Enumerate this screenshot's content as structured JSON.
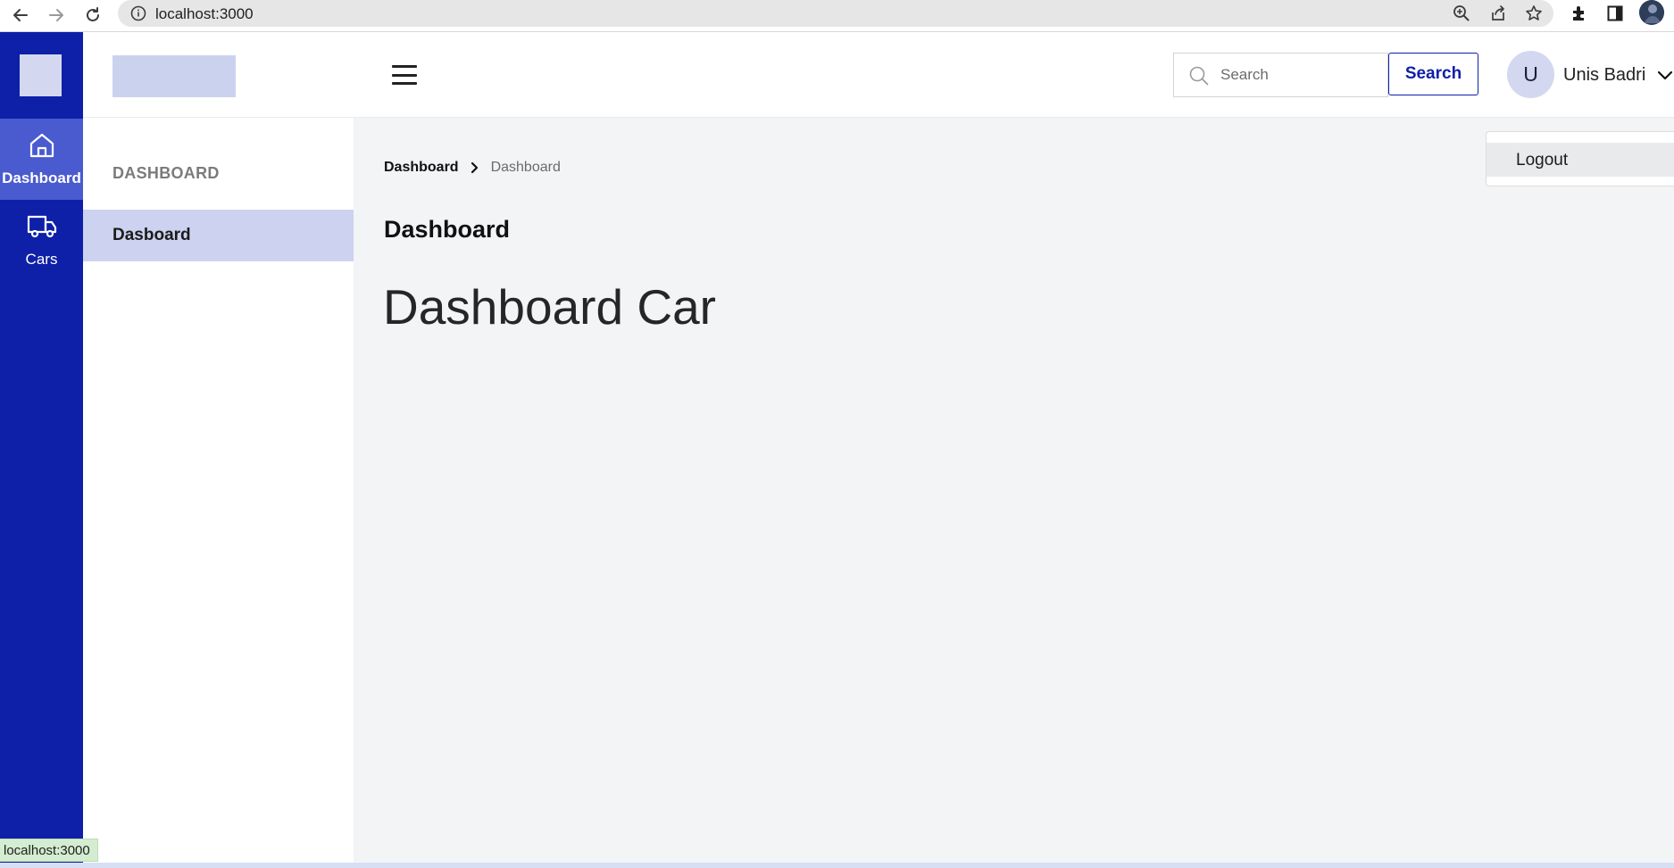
{
  "browser": {
    "url": "localhost:3000",
    "status_url": "localhost:3000"
  },
  "rail": {
    "items": [
      {
        "label": "Dashboard",
        "icon": "home-icon",
        "active": true
      },
      {
        "label": "Cars",
        "icon": "truck-icon",
        "active": false
      }
    ]
  },
  "header": {
    "search_placeholder": "Search",
    "search_button": "Search",
    "avatar_initial": "U",
    "user_name": "Unis Badri"
  },
  "subnav": {
    "title": "DASHBOARD",
    "items": [
      {
        "label": "Dasboard",
        "active": true
      }
    ]
  },
  "main": {
    "breadcrumb": [
      "Dashboard",
      "Dashboard"
    ],
    "title": "Dashboard",
    "hero": "Dashboard Car"
  },
  "dropdown": {
    "items": [
      "Logout"
    ]
  },
  "colors": {
    "primary": "#0e1fa8",
    "rail_active": "#4a5bd0",
    "subnav_active": "#ccd2ef",
    "content_bg": "#f3f4f6"
  }
}
